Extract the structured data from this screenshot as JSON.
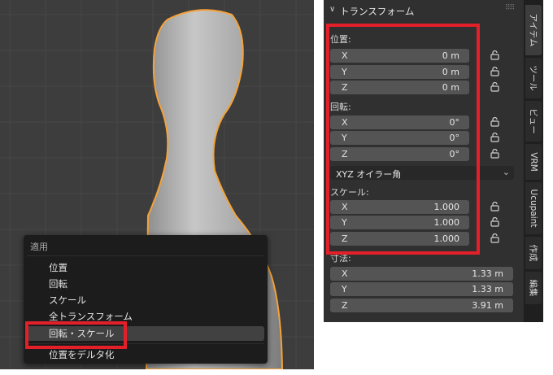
{
  "apply_menu": {
    "title": "適用",
    "items": [
      {
        "label": "位置"
      },
      {
        "label": "回転"
      },
      {
        "label": "スケール"
      },
      {
        "label": "全トランスフォーム"
      },
      {
        "label": "回転・スケール"
      },
      {
        "label": "位置をデルタ化"
      }
    ],
    "highlighted_index": 4
  },
  "panel": {
    "header": "トランスフォーム",
    "location": {
      "label": "位置:",
      "fields": [
        {
          "axis": "X",
          "value": "0 m"
        },
        {
          "axis": "Y",
          "value": "0 m"
        },
        {
          "axis": "Z",
          "value": "0 m"
        }
      ]
    },
    "rotation": {
      "label": "回転:",
      "fields": [
        {
          "axis": "X",
          "value": "0°"
        },
        {
          "axis": "Y",
          "value": "0°"
        },
        {
          "axis": "Z",
          "value": "0°"
        }
      ]
    },
    "rotation_mode": "XYZ オイラー角",
    "scale": {
      "label": "スケール:",
      "fields": [
        {
          "axis": "X",
          "value": "1.000"
        },
        {
          "axis": "Y",
          "value": "1.000"
        },
        {
          "axis": "Z",
          "value": "1.000"
        }
      ]
    },
    "dimensions": {
      "label": "寸法:",
      "fields": [
        {
          "axis": "X",
          "value": "1.33 m"
        },
        {
          "axis": "Y",
          "value": "1.33 m"
        },
        {
          "axis": "Z",
          "value": "3.91 m"
        }
      ]
    }
  },
  "tabs": [
    {
      "label": "アイテム"
    },
    {
      "label": "ツール"
    },
    {
      "label": "ビュー"
    },
    {
      "label": "VRM"
    },
    {
      "label": "Ucupaint"
    },
    {
      "label": "作成"
    },
    {
      "label": "編集"
    }
  ],
  "colors": {
    "highlight_box": "#e3202a",
    "selection_outline": "#f5a23a",
    "viewport_bg": "#3d3d3d",
    "panel_bg": "#303030"
  }
}
